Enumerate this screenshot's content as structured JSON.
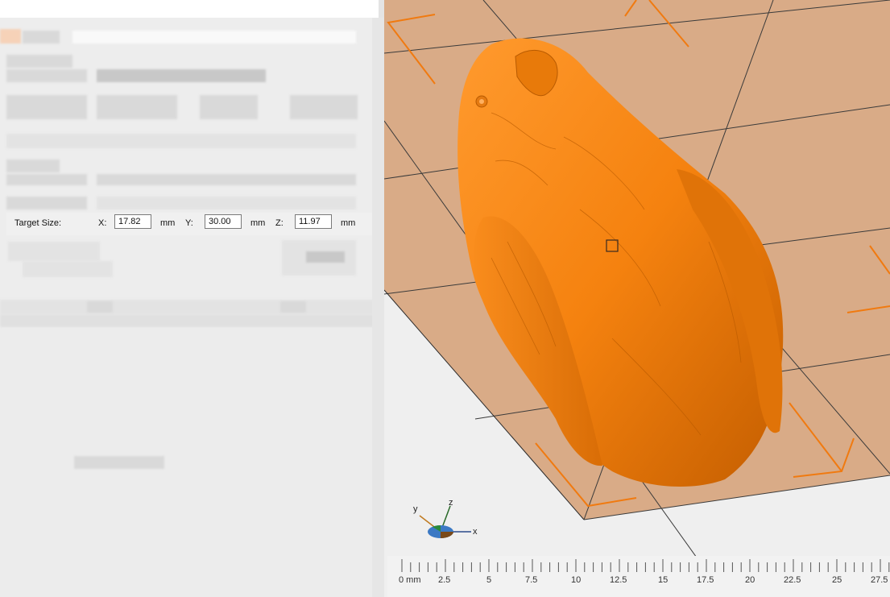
{
  "target_size": {
    "label": "Target Size:",
    "x_label": "X:",
    "x_value": "17.82",
    "y_label": "Y:",
    "y_value": "30.00",
    "z_label": "Z:",
    "z_value": "11.97",
    "unit": "mm"
  },
  "axis_indicator": {
    "y": "y",
    "z": "z",
    "x": "x"
  },
  "ruler": {
    "labels": [
      "0 mm",
      "2.5",
      "5",
      "7.5",
      "10",
      "12.5",
      "15",
      "17.5",
      "20",
      "22.5",
      "25",
      "27.5"
    ]
  },
  "colors": {
    "model": "#f5820f",
    "bed": "#d9ab87",
    "accent_orange": "#f07a10",
    "panel": "#ededed"
  },
  "icons": {
    "viewport_marker": "square-marker-icon",
    "model": "parrot-model"
  }
}
